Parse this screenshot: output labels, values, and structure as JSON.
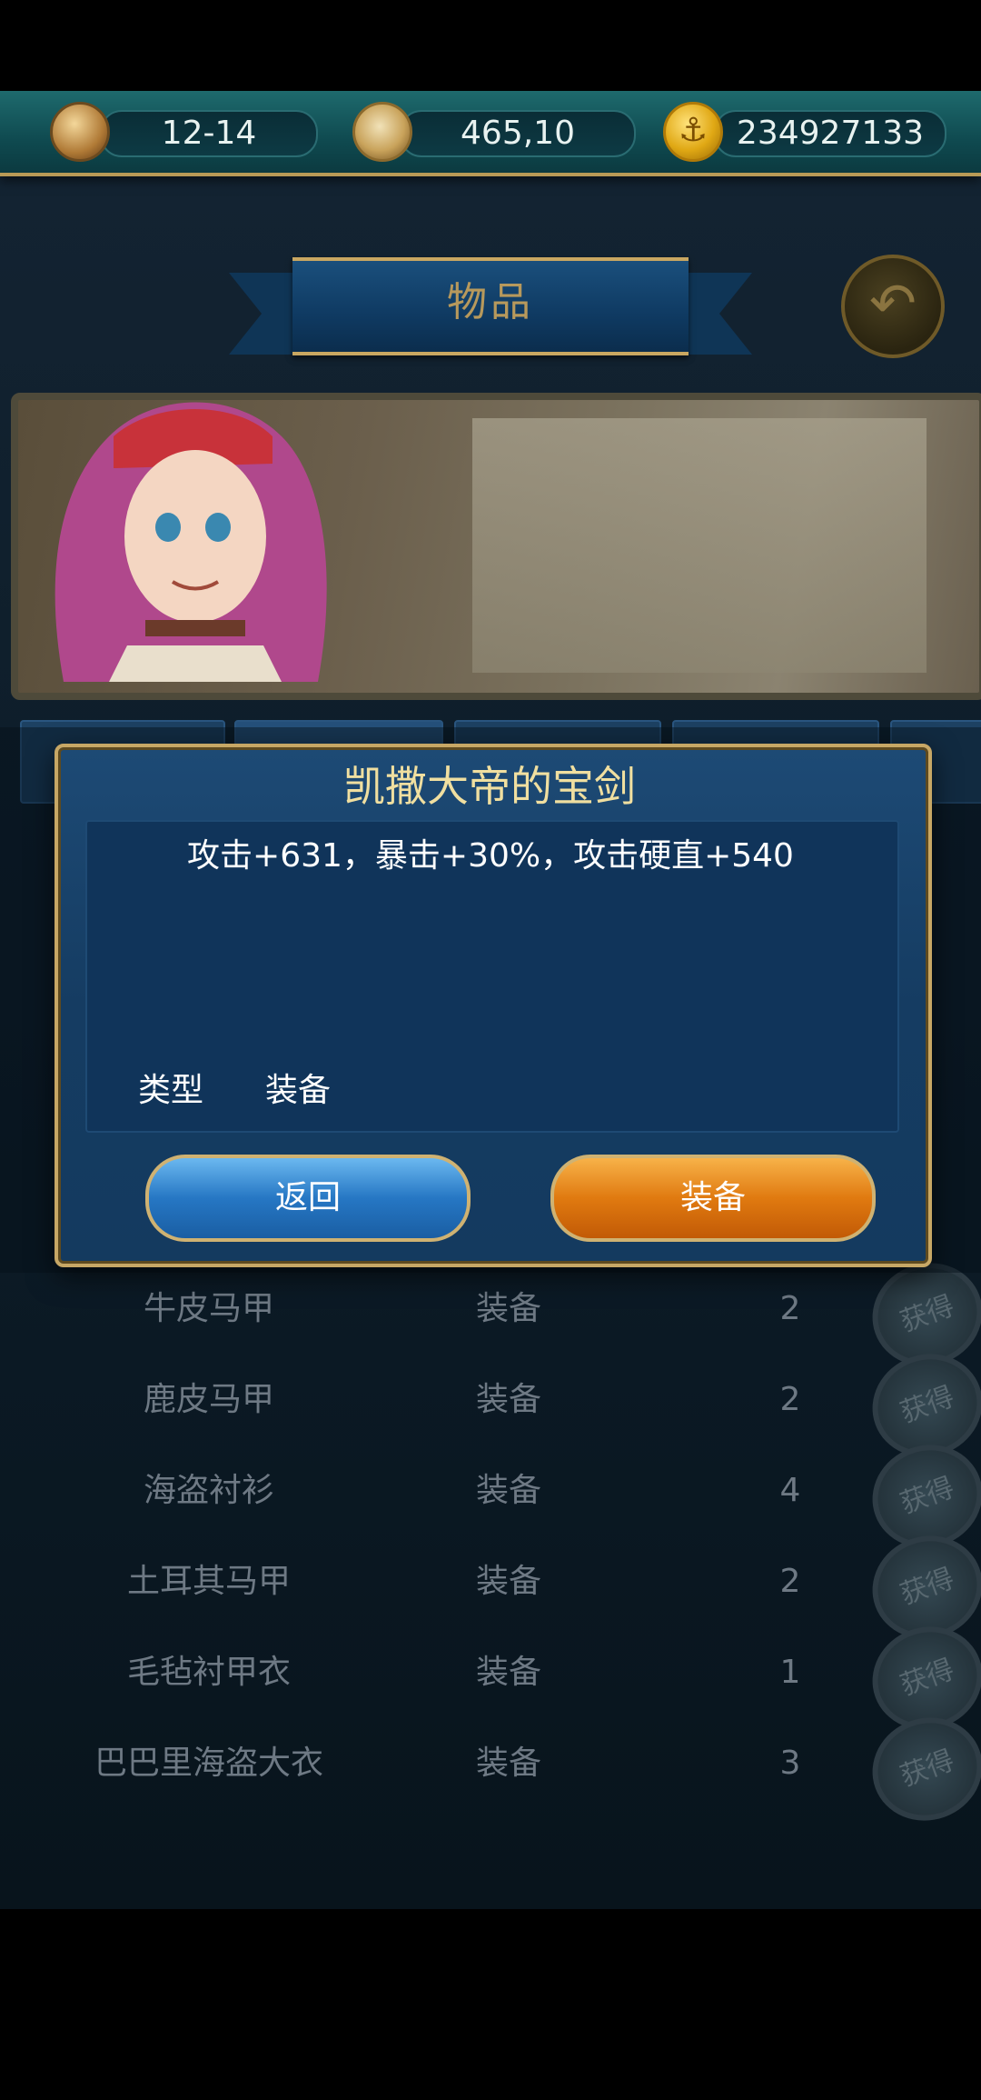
{
  "resources": {
    "date": "12-14",
    "coords": "465,10",
    "gold": "234927133"
  },
  "header": {
    "title": "物品"
  },
  "tabs": [
    "",
    "",
    "",
    "",
    ""
  ],
  "list": {
    "rows": [
      {
        "name": "牛皮马甲",
        "type": "装备",
        "count": "2",
        "obtain": "获得"
      },
      {
        "name": "鹿皮马甲",
        "type": "装备",
        "count": "2",
        "obtain": "获得"
      },
      {
        "name": "海盗衬衫",
        "type": "装备",
        "count": "4",
        "obtain": "获得"
      },
      {
        "name": "土耳其马甲",
        "type": "装备",
        "count": "2",
        "obtain": "获得"
      },
      {
        "name": "毛毡衬甲衣",
        "type": "装备",
        "count": "1",
        "obtain": "获得"
      },
      {
        "name": "巴巴里海盗大衣",
        "type": "装备",
        "count": "3",
        "obtain": "获得"
      }
    ]
  },
  "dialog": {
    "title": "凯撒大帝的宝剑",
    "description": "攻击+631，暴击+30%，攻击硬直+540",
    "type_label": "类型",
    "type_value": "装备",
    "back_label": "返回",
    "equip_label": "装备"
  },
  "colors": {
    "accent_gold": "#c7a765",
    "dialog_bg": "#1d4a75",
    "back_button": "#2677c4",
    "equip_button": "#e07a10"
  }
}
